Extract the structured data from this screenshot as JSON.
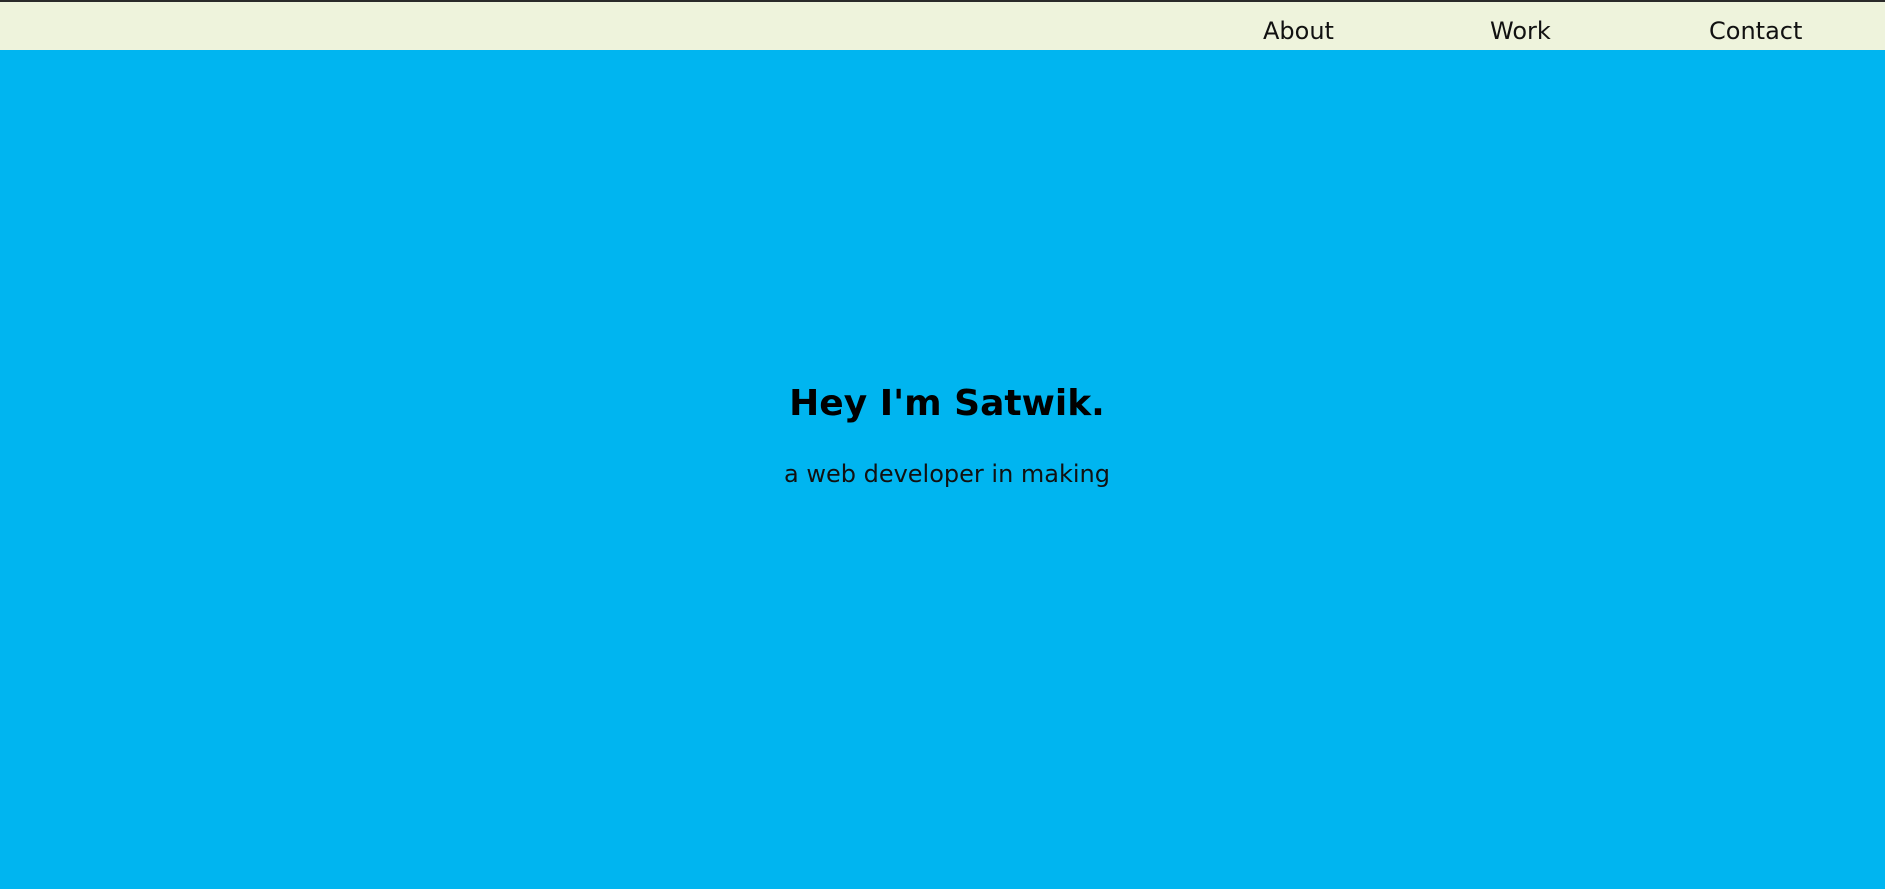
{
  "nav": {
    "items": [
      {
        "label": "About"
      },
      {
        "label": "Work"
      },
      {
        "label": "Contact"
      }
    ]
  },
  "hero": {
    "title": "Hey I'm Satwik.",
    "subtitle": "a web developer in making"
  },
  "colors": {
    "hero_background": "#00b5f0",
    "navbar_background": "#eef3dc",
    "text": "#111111"
  }
}
